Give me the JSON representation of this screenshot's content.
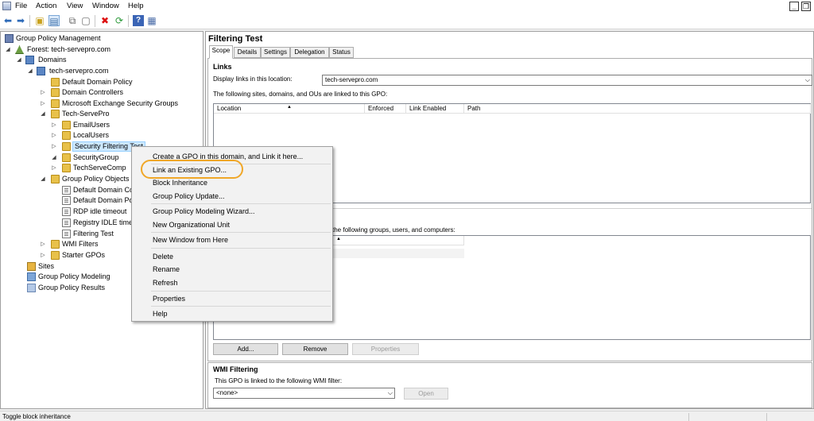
{
  "menubar": {
    "items": [
      "File",
      "Action",
      "View",
      "Window",
      "Help"
    ],
    "minimize_label": "_",
    "restore_label": "❐"
  },
  "toolbar": {
    "icons": [
      "back-arrow-icon",
      "forward-arrow-icon",
      "up-folder-icon",
      "show-hide-tree-icon",
      "copy-icon",
      "paste-icon",
      "delete-icon",
      "refresh-icon",
      "help-icon",
      "properties-icon"
    ]
  },
  "tree": {
    "root": "Group Policy Management",
    "forest": "Forest: tech-servepro.com",
    "domains": "Domains",
    "domain": "tech-servepro.com",
    "default_domain_policy": "Default Domain Policy",
    "domain_controllers": "Domain Controllers",
    "ms_exchange": "Microsoft Exchange Security Groups",
    "tech_servepro": "Tech-ServePro",
    "email_users": "EmailUsers",
    "local_users": "LocalUsers",
    "security_filtering_test": "Security Filtering Test",
    "security_group": "SecurityGroup",
    "techservecomp": "TechServeComp",
    "gpo_objects": "Group Policy Objects",
    "gpo_default_domain_co": "Default Domain Co",
    "gpo_default_domain_po": "Default Domain Po",
    "gpo_rdp_idle": "RDP idle timeout",
    "gpo_registry_idle": "Registry IDLE timeo",
    "gpo_filtering_test": "Filtering Test",
    "wmi_filters": "WMI Filters",
    "starter_gpos": "Starter GPOs",
    "sites": "Sites",
    "gp_modeling": "Group Policy Modeling",
    "gp_results": "Group Policy Results"
  },
  "context_menu": {
    "create_gpo": "Create a GPO in this domain, and Link it here...",
    "link_existing": "Link an Existing GPO...",
    "block_inheritance": "Block Inheritance",
    "gp_update": "Group Policy Update...",
    "modeling_wizard": "Group Policy Modeling Wizard...",
    "new_ou": "New Organizational Unit",
    "new_window": "New Window from Here",
    "delete": "Delete",
    "rename": "Rename",
    "refresh": "Refresh",
    "properties": "Properties",
    "help": "Help"
  },
  "details": {
    "title": "Filtering Test",
    "tabs": [
      "Scope",
      "Details",
      "Settings",
      "Delegation",
      "Status"
    ],
    "links_heading": "Links",
    "display_links_label": "Display links in this location:",
    "display_links_value": "tech-servepro.com",
    "linked_text": "The following sites, domains, and OUs are linked to this GPO:",
    "link_columns": [
      "Location",
      "Enforced",
      "Link Enabled",
      "Path"
    ],
    "filter_text_visible": "the following groups, users, and computers:",
    "add_button": "Add...",
    "remove_button": "Remove",
    "properties_button": "Properties",
    "wmi_heading": "WMI Filtering",
    "wmi_text": "This GPO is linked to the following WMI filter:",
    "wmi_value": "<none>",
    "open_button": "Open"
  },
  "status_bar": {
    "text": "Toggle block inheritance"
  }
}
